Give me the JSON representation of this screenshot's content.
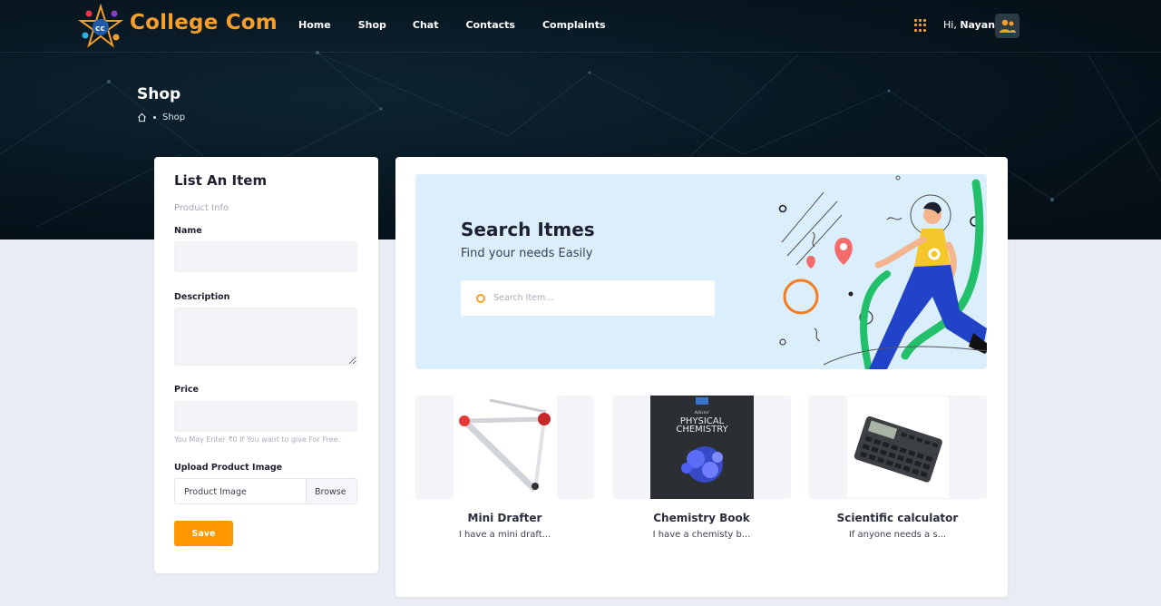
{
  "header": {
    "brand": "College Com",
    "nav": [
      {
        "label": "Home"
      },
      {
        "label": "Shop"
      },
      {
        "label": "Chat"
      },
      {
        "label": "Contacts"
      },
      {
        "label": "Complaints"
      }
    ],
    "greeting_prefix": "Hi,",
    "user_name": "Nayan"
  },
  "page": {
    "title": "Shop",
    "breadcrumb": "Shop"
  },
  "list_item_form": {
    "title": "List An Item",
    "section": "Product Info",
    "name_label": "Name",
    "description_label": "Description",
    "price_label": "Price",
    "price_hint": "You May Enter ₹0 If You want to give For Free.",
    "upload_label": "Upload Product Image",
    "file_placeholder": "Product Image",
    "browse_label": "Browse",
    "save_label": "Save"
  },
  "search": {
    "title": "Search Itmes",
    "subtitle": "Find your needs Easily",
    "placeholder": "Search Item..."
  },
  "products": [
    {
      "title": "Mini Drafter",
      "desc": "I have a mini draft..."
    },
    {
      "title": "Chemistry Book",
      "desc": "I have a chemisty b..."
    },
    {
      "title": "Scientific calculator",
      "desc": "If anyone needs a s..."
    }
  ],
  "book_cover": {
    "line1": "Atkins'",
    "line2": "PHYSICAL",
    "line3": "CHEMISTRY"
  },
  "colors": {
    "accent": "#f59f2a",
    "button": "#ff9800",
    "banner": "#daeefb",
    "hero": "#07141d"
  }
}
